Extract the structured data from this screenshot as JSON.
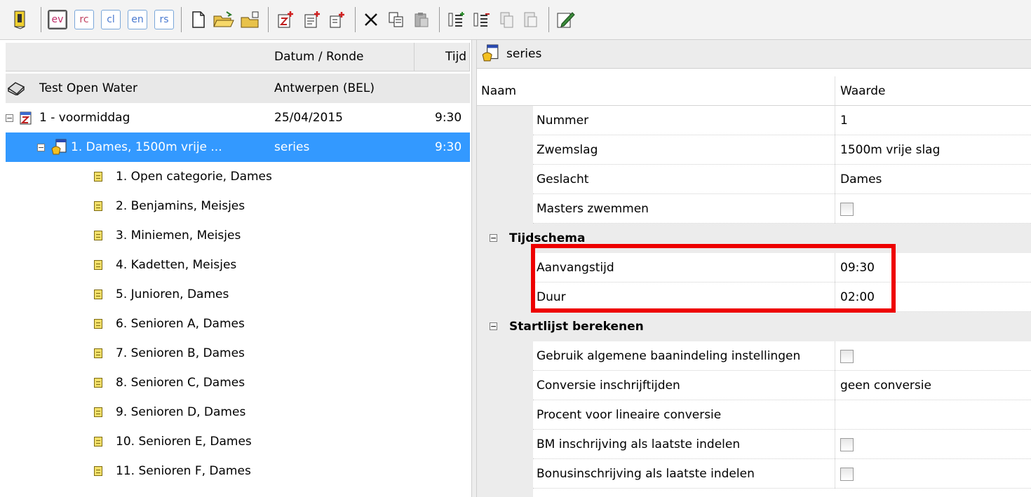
{
  "toolbar": {
    "mode_buttons": [
      {
        "label": "ev",
        "active": true
      },
      {
        "label": "rc",
        "active": false
      },
      {
        "label": "cl",
        "active": false
      },
      {
        "label": "en",
        "active": false
      },
      {
        "label": "rs",
        "active": false
      }
    ],
    "icons": [
      "exit-icon",
      "new-file-icon",
      "open-folder-icon",
      "open-file-icon",
      "add-session-icon",
      "add-event-icon",
      "add-sub-icon",
      "delete-icon",
      "copy-icon",
      "paste-icon",
      "move-up-icon",
      "move-down-icon",
      "copy-doc-icon",
      "paste-doc-icon",
      "edit-icon"
    ]
  },
  "tree": {
    "columns": {
      "name": "",
      "date_round": "Datum / Ronde",
      "time": "Tijd"
    },
    "meet": {
      "name": "Test Open Water",
      "location": "Antwerpen  (BEL)"
    },
    "session": {
      "name": "1 - voormiddag",
      "date": "25/04/2015",
      "time": "9:30"
    },
    "event": {
      "name": "1. Dames, 1500m vrije ...",
      "round": "series",
      "time": "9:30"
    },
    "categories": [
      "1. Open categorie, Dames",
      "2. Benjamins, Meisjes",
      "3. Miniemen, Meisjes",
      "4. Kadetten, Meisjes",
      "5. Junioren, Dames",
      "6. Senioren A, Dames",
      "7. Senioren B, Dames",
      "8. Senioren C, Dames",
      "9. Senioren D, Dames",
      "10. Senioren E, Dames",
      "11. Senioren F, Dames"
    ]
  },
  "properties": {
    "title": "series",
    "header": {
      "name": "Naam",
      "value": "Waarde"
    },
    "general": [
      {
        "name": "Nummer",
        "value": "1"
      },
      {
        "name": "Zwemslag",
        "value": "1500m vrije slag"
      },
      {
        "name": "Geslacht",
        "value": "Dames"
      },
      {
        "name": "Masters zwemmen",
        "value": ""
      }
    ],
    "tijdschema": {
      "title": "Tijdschema",
      "rows": [
        {
          "name": "Aanvangstijd",
          "value": "09:30"
        },
        {
          "name": "Duur",
          "value": "02:00"
        }
      ]
    },
    "startlijst": {
      "title": "Startlijst berekenen",
      "rows": [
        {
          "name": "Gebruik algemene baanindeling instellingen",
          "value": ""
        },
        {
          "name": "Conversie inschrijftijden",
          "value": "geen conversie"
        },
        {
          "name": "Procent voor lineaire conversie",
          "value": ""
        },
        {
          "name": "BM inschrijving als laatste indelen",
          "value": ""
        },
        {
          "name": "Bonusinschrijving als laatste indelen",
          "value": ""
        }
      ]
    }
  },
  "colors": {
    "selection": "#3399ff",
    "highlight": "#ee0000"
  }
}
